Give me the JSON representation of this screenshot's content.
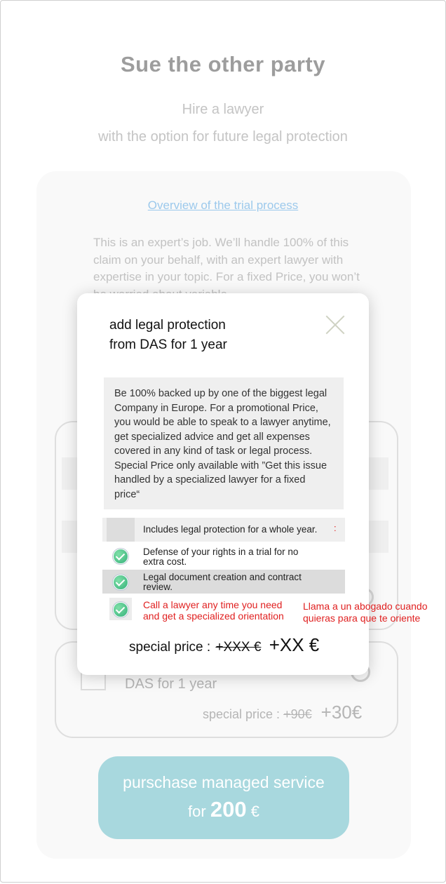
{
  "header": {
    "title": "Sue the other party",
    "subtitle_line1": "Hire a lawyer",
    "subtitle_line2": "with the option for future legal protection"
  },
  "card": {
    "overview_link": "Overview of the trial process",
    "description": "This is an expert’s job. We’ll handle 100% of this claim on your behalf, with an expert lawyer with expertise in your topic. For a fixed Price, you won’t be worried about variable",
    "das_option_label": "DAS for 1 year",
    "special_price_label": "special price :",
    "old_price": "+90€",
    "new_price": "+30€"
  },
  "purchase_button": {
    "line1": "purschase managed service",
    "line2_prefix": "for",
    "amount": "200",
    "currency": "€"
  },
  "modal": {
    "title_line1": "add legal protection",
    "title_line2": "from DAS for 1 year",
    "description": "Be 100% backed up by one of the biggest legal Company in Europe. For a promotional Price, you would be able to speak to a lawyer anytime, get specialized advice and get all expenses covered in any kind of task or legal process. Special Price only available with ”Get this issue handled by a specialized lawyer for a fixed price“",
    "features_header": "Includes legal protection for a whole year.",
    "header_mark": ":",
    "features": [
      {
        "line1": "Defense of your rights in a trial for no",
        "line2": "extra cost.",
        "icon": "check-icon"
      },
      {
        "line1": "Legal document creation and contract",
        "line2": "review.",
        "icon": "check-icon"
      },
      {
        "line1": "Call a lawyer any time you need",
        "line2": "and get a specialized orientation",
        "icon": "check-icon"
      }
    ],
    "special_price_label": "special price :",
    "old_price": "+XXX €",
    "new_price": "+XX €"
  },
  "annotation": {
    "line1": "Llama a un abogado cuando",
    "line2": "quieras para que te oriente"
  },
  "colors": {
    "accent_button": "#a8d8de",
    "link": "#9cc9ec",
    "annotation_red": "#e02020",
    "check_green": "#35b07a"
  }
}
